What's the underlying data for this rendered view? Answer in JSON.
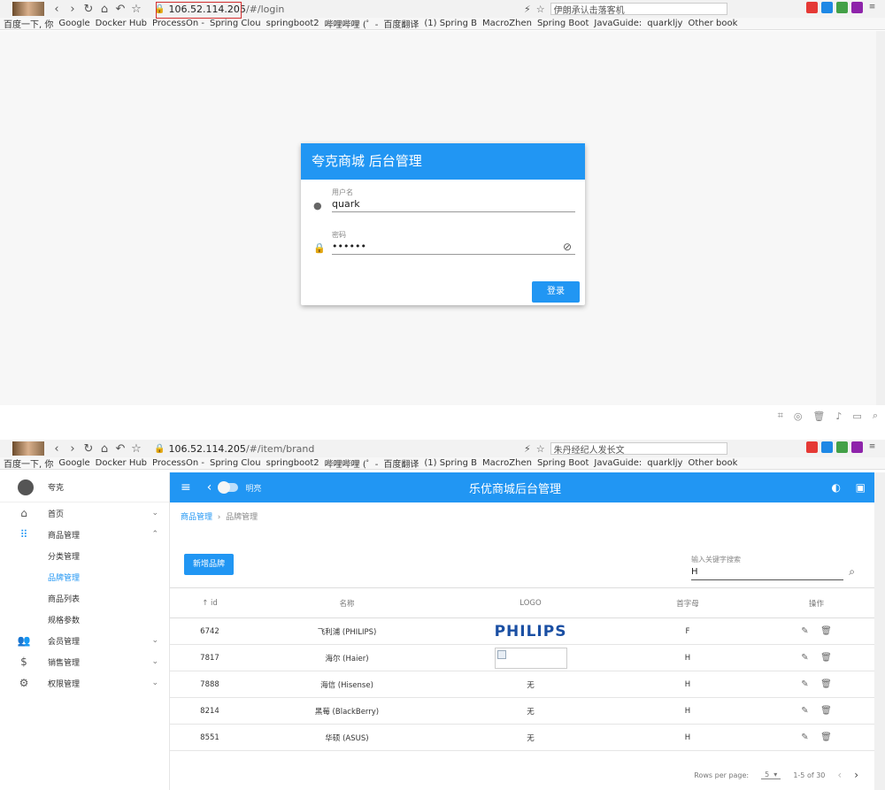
{
  "login_window": {
    "url_host": "106.52.114.205",
    "url_path": "/#/login",
    "search_text": "伊朗承认击落客机",
    "login": {
      "title": "夸克商城 后台管理",
      "username_label": "用户名",
      "username_value": "quark",
      "password_label": "密码",
      "password_value": "••••••",
      "submit_label": "登录"
    }
  },
  "brand_window": {
    "url_host": "106.52.114.205",
    "url_path": "/#/item/brand",
    "search_text": "朱丹经纪人发长文"
  },
  "bookmarks": [
    "百度一下, 你",
    "Google",
    "Docker Hub",
    "ProcessOn -",
    "Spring Clou",
    "springboot2",
    "哔哩哔哩 (゜-",
    "百度翻译",
    "(1) Spring B",
    "MacroZhen",
    "Spring Boot",
    "JavaGuide:",
    "quarkljy",
    "Other book"
  ],
  "app": {
    "user_name": "夸克",
    "appbar_title": "乐优商城后台管理",
    "theme_label": "明亮",
    "sidebar": [
      {
        "label": "首页",
        "icon": "home-icon",
        "expanded": false
      },
      {
        "label": "商品管理",
        "icon": "apps-icon",
        "expanded": true,
        "children": [
          "分类管理",
          "品牌管理",
          "商品列表",
          "规格参数"
        ]
      },
      {
        "label": "会员管理",
        "icon": "people-icon",
        "expanded": false
      },
      {
        "label": "销售管理",
        "icon": "dollar-icon",
        "expanded": false
      },
      {
        "label": "权限管理",
        "icon": "gear-icon",
        "expanded": false
      }
    ],
    "breadcrumb": [
      "商品管理",
      "品牌管理"
    ],
    "add_button": "新增品牌",
    "search_label": "输入关键字搜索",
    "search_value": "H",
    "table": {
      "headers": [
        "id",
        "名称",
        "LOGO",
        "首字母",
        "操作"
      ],
      "rows": [
        {
          "id": "6742",
          "name": "飞利浦 (PHILIPS)",
          "logo": "PHILIPS",
          "letter": "F"
        },
        {
          "id": "7817",
          "name": "海尔 (Haier)",
          "logo": "",
          "letter": "H"
        },
        {
          "id": "7888",
          "name": "海信 (Hisense)",
          "logo": "无",
          "letter": "H"
        },
        {
          "id": "8214",
          "name": "黑莓 (BlackBerry)",
          "logo": "无",
          "letter": "H"
        },
        {
          "id": "8551",
          "name": "华硕 (ASUS)",
          "logo": "无",
          "letter": "H"
        }
      ]
    },
    "pager": {
      "rows_per_page_label": "Rows per page:",
      "rows_per_page": "5",
      "range": "1-5 of 30"
    }
  },
  "colors": {
    "primary": "#2196f3",
    "url_highlight": "#d32f2f"
  }
}
